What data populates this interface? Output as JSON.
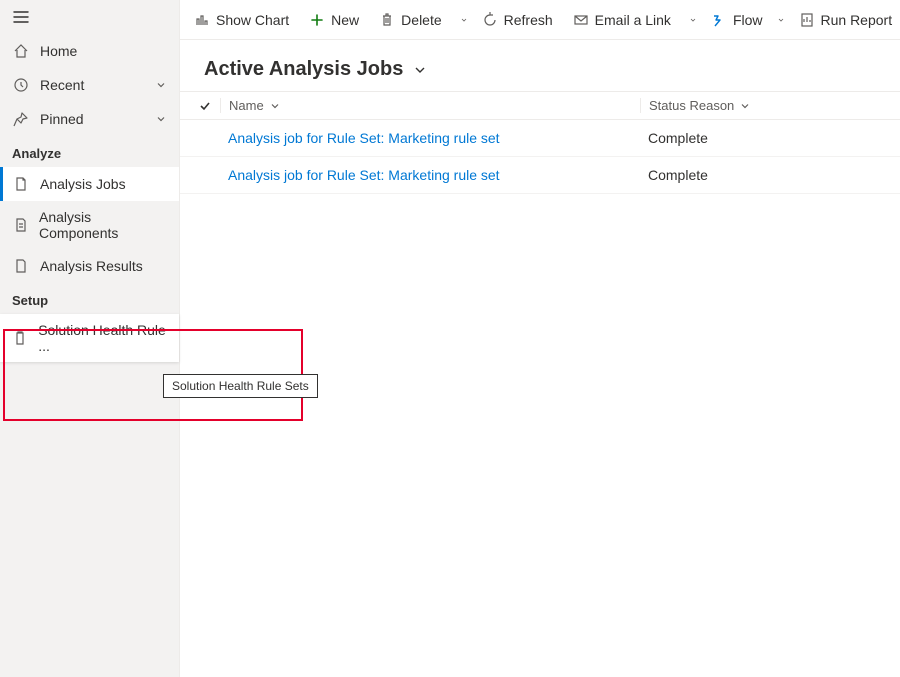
{
  "sidebar": {
    "top": {
      "home": "Home",
      "recent": "Recent",
      "pinned": "Pinned"
    },
    "section_analyze": "Analyze",
    "analyze": {
      "analysis_jobs": "Analysis Jobs",
      "analysis_components": "Analysis Components",
      "analysis_results": "Analysis Results"
    },
    "section_setup": "Setup",
    "setup": {
      "solution_health_rule_sets_truncated": "Solution Health Rule ...",
      "solution_health_rule_sets_full": "Solution Health Rule Sets"
    }
  },
  "commandbar": {
    "show_chart": "Show Chart",
    "new": "New",
    "delete": "Delete",
    "refresh": "Refresh",
    "email_a_link": "Email a Link",
    "flow": "Flow",
    "run_report": "Run Report"
  },
  "view": {
    "title": "Active Analysis Jobs"
  },
  "grid": {
    "columns": {
      "name": "Name",
      "status_reason": "Status Reason"
    },
    "rows": [
      {
        "name": "Analysis job for Rule Set: Marketing rule set",
        "status": "Complete"
      },
      {
        "name": "Analysis job for Rule Set: Marketing rule set",
        "status": "Complete"
      }
    ]
  }
}
